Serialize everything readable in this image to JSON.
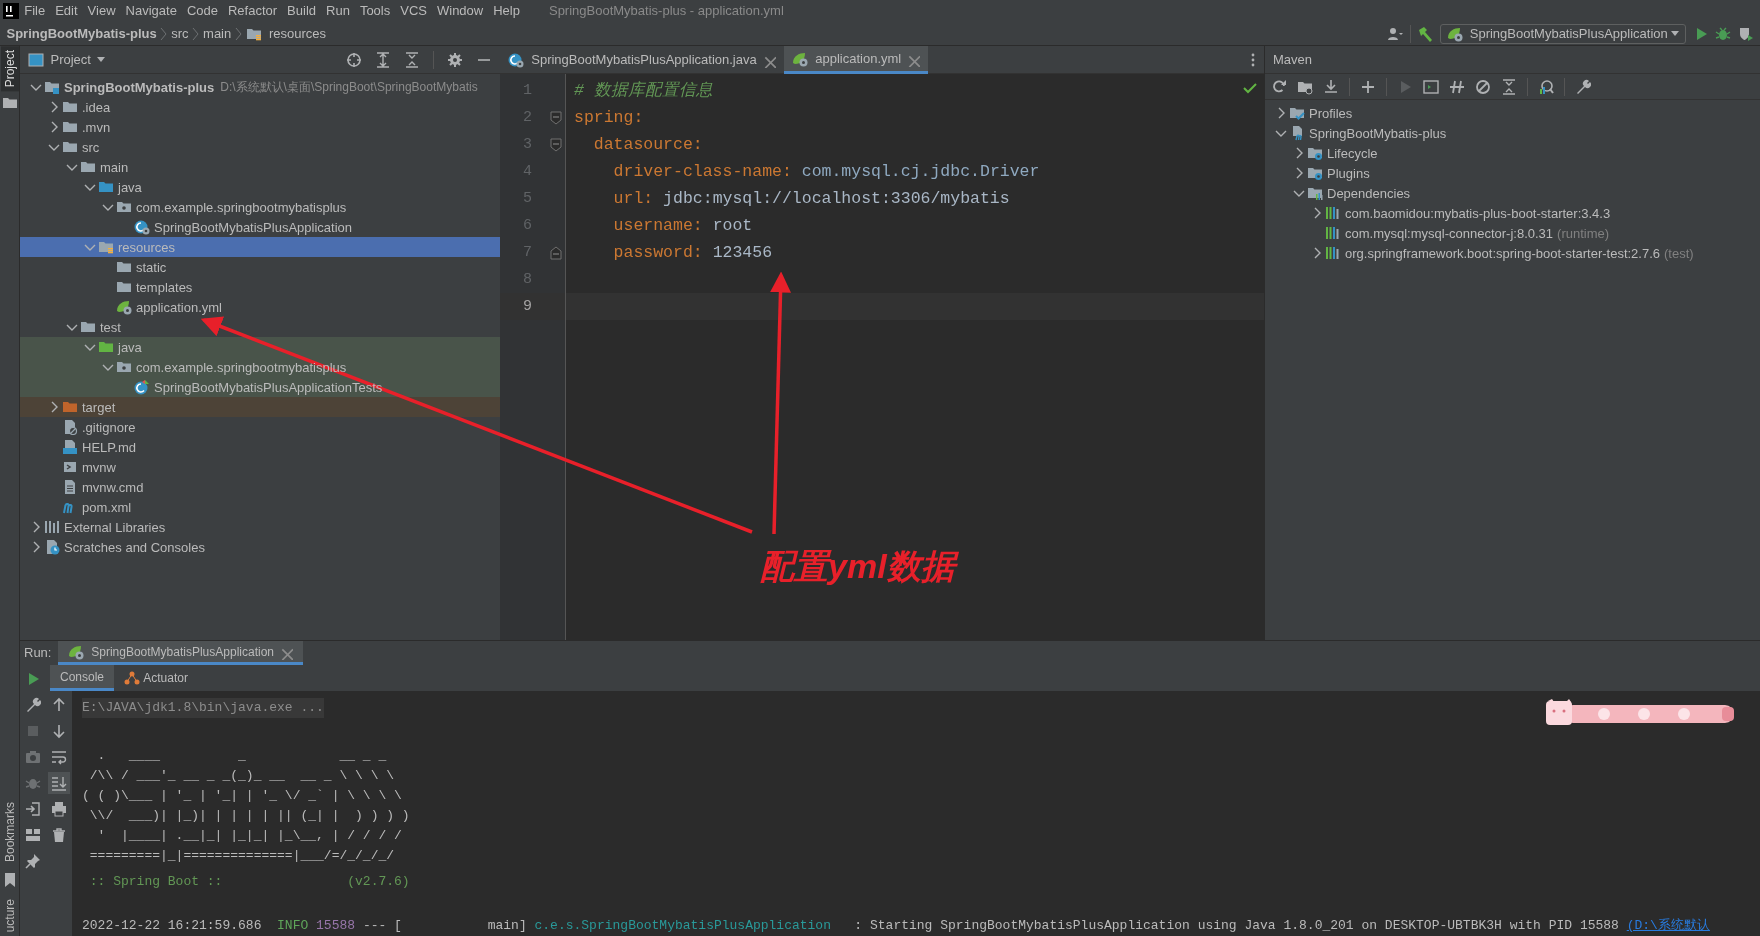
{
  "window": {
    "title": "SpringBootMybatis-plus - application.yml"
  },
  "menu": [
    "File",
    "Edit",
    "View",
    "Navigate",
    "Code",
    "Refactor",
    "Build",
    "Run",
    "Tools",
    "VCS",
    "Window",
    "Help"
  ],
  "breadcrumb": [
    {
      "label": "SpringBootMybatis-plus",
      "kind": "project"
    },
    {
      "label": "src",
      "kind": "folder"
    },
    {
      "label": "main",
      "kind": "folder"
    },
    {
      "label": "resources",
      "kind": "resources"
    }
  ],
  "toolbar": {
    "run_config": "SpringBootMybatisPlusApplication"
  },
  "stripe": {
    "top": [
      {
        "label": "Project",
        "selected": true
      }
    ],
    "bottom": [
      {
        "label": "Bookmarks",
        "selected": false
      },
      {
        "label": "ucture",
        "selected": false
      }
    ]
  },
  "project_panel": {
    "title": "Project",
    "tree": [
      {
        "label": "SpringBootMybatis-plus",
        "path": "D:\\系统默认\\桌面\\SpringBoot\\SpringBootMybatis",
        "kind": "module",
        "expanded": true,
        "selected": false,
        "children": [
          {
            "label": ".idea",
            "kind": "folder",
            "expanded": false,
            "selected": false
          },
          {
            "label": ".mvn",
            "kind": "folder",
            "expanded": false,
            "selected": false
          },
          {
            "label": "src",
            "kind": "folder",
            "expanded": true,
            "selected": false,
            "children": [
              {
                "label": "main",
                "kind": "folder",
                "expanded": true,
                "selected": false,
                "children": [
                  {
                    "label": "java",
                    "kind": "source-folder",
                    "expanded": true,
                    "selected": false,
                    "children": [
                      {
                        "label": "com.example.springbootmybatisplus",
                        "kind": "package",
                        "expanded": true,
                        "selected": false,
                        "children": [
                          {
                            "label": "SpringBootMybatisPlusApplication",
                            "kind": "spring-class",
                            "selected": false
                          }
                        ]
                      }
                    ]
                  },
                  {
                    "label": "resources",
                    "kind": "resources-folder",
                    "expanded": true,
                    "selected": true,
                    "children": [
                      {
                        "label": "static",
                        "kind": "folder",
                        "selected": false
                      },
                      {
                        "label": "templates",
                        "kind": "folder",
                        "selected": false
                      },
                      {
                        "label": "application.yml",
                        "kind": "spring-config",
                        "selected": false
                      }
                    ]
                  }
                ]
              },
              {
                "label": "test",
                "kind": "folder",
                "expanded": true,
                "selected": false,
                "children": [
                  {
                    "label": "java",
                    "kind": "test-folder",
                    "expanded": true,
                    "selected": false,
                    "test": true,
                    "children": [
                      {
                        "label": "com.example.springbootmybatisplus",
                        "kind": "package",
                        "expanded": true,
                        "selected": false,
                        "test": true,
                        "children": [
                          {
                            "label": "SpringBootMybatisPlusApplicationTests",
                            "kind": "test-class",
                            "selected": false,
                            "test": true
                          }
                        ]
                      }
                    ]
                  }
                ]
              }
            ]
          },
          {
            "label": "target",
            "kind": "excluded-folder",
            "expanded": false,
            "selected": false,
            "excluded": true
          },
          {
            "label": ".gitignore",
            "kind": "ignore-file",
            "selected": false
          },
          {
            "label": "HELP.md",
            "kind": "md-file",
            "selected": false
          },
          {
            "label": "mvnw",
            "kind": "script-file",
            "selected": false
          },
          {
            "label": "mvnw.cmd",
            "kind": "text-file",
            "selected": false
          },
          {
            "label": "pom.xml",
            "kind": "maven-file",
            "selected": false
          }
        ]
      },
      {
        "label": "External Libraries",
        "kind": "libraries",
        "expanded": false,
        "selected": false
      },
      {
        "label": "Scratches and Consoles",
        "kind": "scratches",
        "expanded": false,
        "selected": false
      }
    ]
  },
  "editor": {
    "tabs": [
      {
        "label": "SpringBootMybatisPlusApplication.java",
        "kind": "spring-class",
        "selected": false
      },
      {
        "label": "application.yml",
        "kind": "spring-config",
        "selected": true
      }
    ],
    "lines": [
      {
        "number": "1",
        "current": false,
        "tokens": [
          {
            "kind": "comment",
            "text": "# 数据库配置信息"
          }
        ]
      },
      {
        "number": "2",
        "current": false,
        "fold_start": true,
        "tokens": [
          {
            "kind": "key",
            "text": "spring"
          },
          {
            "kind": "punct",
            "text": ":"
          }
        ]
      },
      {
        "number": "3",
        "current": false,
        "fold_start": true,
        "tokens": [
          {
            "kind": "key",
            "text": "  datasource"
          },
          {
            "kind": "punct",
            "text": ":"
          }
        ]
      },
      {
        "number": "4",
        "current": false,
        "tokens": [
          {
            "kind": "key",
            "text": "    driver-class-name"
          },
          {
            "kind": "punct",
            "text": ":"
          },
          {
            "kind": "reference",
            "text": " com.mysql.cj.jdbc.Driver"
          }
        ]
      },
      {
        "number": "5",
        "current": false,
        "tokens": [
          {
            "kind": "key",
            "text": "    url"
          },
          {
            "kind": "punct",
            "text": ":"
          },
          {
            "kind": "value",
            "text": " jdbc:mysql://localhost:3306/mybatis"
          }
        ]
      },
      {
        "number": "6",
        "current": false,
        "tokens": [
          {
            "kind": "key",
            "text": "    username"
          },
          {
            "kind": "punct",
            "text": ":"
          },
          {
            "kind": "value",
            "text": " root"
          }
        ]
      },
      {
        "number": "7",
        "current": false,
        "fold_end": true,
        "tokens": [
          {
            "kind": "key",
            "text": "    password"
          },
          {
            "kind": "punct",
            "text": ":"
          },
          {
            "kind": "value",
            "text": " 123456"
          }
        ]
      },
      {
        "number": "8",
        "current": false
      },
      {
        "number": "9",
        "current": true
      }
    ]
  },
  "maven": {
    "title": "Maven",
    "tree": [
      {
        "label": "Profiles",
        "kind": "profiles",
        "expanded": false
      },
      {
        "label": "SpringBootMybatis-plus",
        "kind": "maven-module",
        "expanded": true,
        "children": [
          {
            "label": "Lifecycle",
            "kind": "lifecycle",
            "expanded": false
          },
          {
            "label": "Plugins",
            "kind": "plugins",
            "expanded": false
          },
          {
            "label": "Dependencies",
            "kind": "dependencies",
            "expanded": true,
            "children": [
              {
                "label": "com.baomidou:mybatis-plus-boot-starter:3.4.3",
                "kind": "dependency",
                "expanded": false
              },
              {
                "label": "com.mysql:mysql-connector-j:8.0.31",
                "note": "(runtime)",
                "kind": "dependency"
              },
              {
                "label": "org.springframework.boot:spring-boot-starter-test:2.7.6",
                "note": "(test)",
                "kind": "dependency",
                "expanded": false
              }
            ]
          }
        ]
      }
    ]
  },
  "run": {
    "label": "Run:",
    "tab": "SpringBootMybatisPlusApplication",
    "tabs": [
      {
        "label": "Console",
        "selected": true
      },
      {
        "label": "Actuator",
        "selected": false
      }
    ],
    "lines": [
      {
        "kind": "command",
        "text": "E:\\JAVA\\jdk1.8\\bin\\java.exe ..."
      },
      {
        "kind": "banner",
        "text": "  .   ____          _            __ _ _"
      },
      {
        "kind": "banner",
        "text": " /\\\\ / ___'_ __ _ _(_)_ __  __ _ \\ \\ \\ \\"
      },
      {
        "kind": "banner",
        "text": "( ( )\\___ | '_ | '_| | '_ \\/ _` | \\ \\ \\ \\"
      },
      {
        "kind": "banner",
        "text": " \\\\/  ___)| |_)| | | | | || (_| |  ) ) ) )"
      },
      {
        "kind": "banner",
        "text": "  '  |____| .__|_| |_|_| |_\\__, | / / / /"
      },
      {
        "kind": "banner",
        "text": " =========|_|==============|___/=/_/_/_/"
      },
      {
        "kind": "boot",
        "text": " :: Spring Boot ::                (v2.7.6)"
      },
      {
        "kind": "log",
        "parts": [
          {
            "kind": "plain",
            "text": "2022-12-22 16:21:59.686  "
          },
          {
            "kind": "level",
            "text": "INFO"
          },
          {
            "kind": "pid",
            "text": " 15588"
          },
          {
            "kind": "plain",
            "text": " --- [           main] "
          },
          {
            "kind": "logger",
            "text": "c.e.s.SpringBootMybatisPlusApplication"
          },
          {
            "kind": "plain",
            "text": "   : Starting SpringBootMybatisPlusApplication using Java 1.8.0_201 on DESKTOP-UBTBK3H with PID 15588 "
          },
          {
            "kind": "link",
            "text": "(D:\\系统默认"
          }
        ]
      }
    ]
  },
  "annotation": {
    "text": "配置yml数据"
  }
}
